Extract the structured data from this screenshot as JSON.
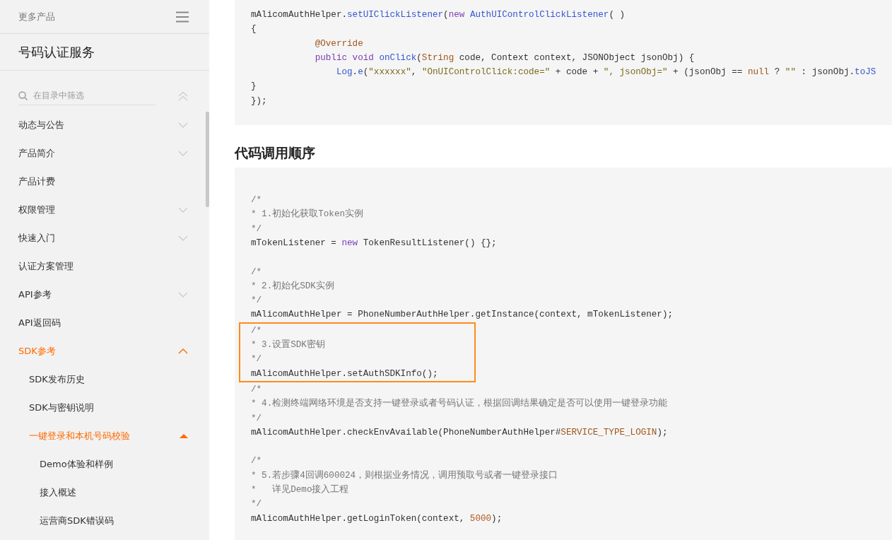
{
  "sidebar": {
    "header": {
      "label": "更多产品"
    },
    "title": "号码认证服务",
    "filter": {
      "placeholder": "在目录中筛选"
    },
    "items": [
      {
        "label": "动态与公告",
        "expandable": true,
        "expanded": false,
        "active": false
      },
      {
        "label": "产品简介",
        "expandable": true,
        "expanded": false,
        "active": false
      },
      {
        "label": "产品计费",
        "expandable": false,
        "active": false
      },
      {
        "label": "权限管理",
        "expandable": true,
        "expanded": false,
        "active": false
      },
      {
        "label": "快速入门",
        "expandable": true,
        "expanded": false,
        "active": false
      },
      {
        "label": "认证方案管理",
        "expandable": false,
        "active": false
      },
      {
        "label": "API参考",
        "expandable": true,
        "expanded": false,
        "active": false
      },
      {
        "label": "API返回码",
        "expandable": false,
        "active": false
      },
      {
        "label": "SDK参考",
        "expandable": true,
        "expanded": true,
        "active": true,
        "children": [
          {
            "label": "SDK发布历史",
            "expandable": false,
            "active": false
          },
          {
            "label": "SDK与密钥说明",
            "expandable": false,
            "active": false
          },
          {
            "label": "一键登录和本机号码校验",
            "expandable": true,
            "expanded": true,
            "active": true,
            "children": [
              {
                "label": "Demo体验和样例",
                "expandable": false,
                "active": false
              },
              {
                "label": "接入概述",
                "expandable": false,
                "active": false
              },
              {
                "label": "运营商SDK错误码",
                "expandable": false,
                "active": false
              }
            ]
          }
        ]
      }
    ]
  },
  "content": {
    "code_blocks": [
      {
        "sections": [
          {
            "highlighted": false,
            "lines": [
              {
                "kind": "code",
                "segments": [
                  {
                    "text": "mAlicomAuthHelper.",
                    "kind": "plain"
                  },
                  {
                    "text": "setUIClickListener",
                    "kind": "func"
                  },
                  {
                    "text": "(",
                    "kind": "plain"
                  },
                  {
                    "text": "new",
                    "kind": "keyword"
                  },
                  {
                    "text": " AuthUIControlClickListener",
                    "kind": "func"
                  },
                  {
                    "text": "( )",
                    "kind": "plain"
                  }
                ]
              },
              {
                "kind": "code",
                "segments": [
                  {
                    "text": "{",
                    "kind": "plain"
                  }
                ]
              },
              {
                "kind": "code",
                "segments": [
                  {
                    "text": "            @Override",
                    "kind": "meta"
                  }
                ]
              },
              {
                "kind": "code",
                "segments": [
                  {
                    "text": "            public void",
                    "kind": "keyword"
                  },
                  {
                    "text": " onClick",
                    "kind": "func"
                  },
                  {
                    "text": "(",
                    "kind": "plain"
                  },
                  {
                    "text": "String",
                    "kind": "type"
                  },
                  {
                    "text": " code, Context context, JSONObject jsonObj) {",
                    "kind": "plain"
                  }
                ]
              },
              {
                "kind": "code",
                "segments": [
                  {
                    "text": "                Log",
                    "kind": "func"
                  },
                  {
                    "text": ".",
                    "kind": "plain"
                  },
                  {
                    "text": "e",
                    "kind": "func"
                  },
                  {
                    "text": "(",
                    "kind": "plain"
                  },
                  {
                    "text": "\"xxxxxx\"",
                    "kind": "string"
                  },
                  {
                    "text": ", ",
                    "kind": "plain"
                  },
                  {
                    "text": "\"OnUIControlClick:code=\"",
                    "kind": "string"
                  },
                  {
                    "text": " + code + ",
                    "kind": "plain"
                  },
                  {
                    "text": "\", jsonObj=\"",
                    "kind": "string"
                  },
                  {
                    "text": " + (jsonObj == ",
                    "kind": "plain"
                  },
                  {
                    "text": "null",
                    "kind": "type"
                  },
                  {
                    "text": " ? ",
                    "kind": "plain"
                  },
                  {
                    "text": "\"\"",
                    "kind": "string"
                  },
                  {
                    "text": " : jsonObj.",
                    "kind": "plain"
                  },
                  {
                    "text": "toJS",
                    "kind": "func"
                  }
                ]
              },
              {
                "kind": "code",
                "segments": [
                  {
                    "text": "}",
                    "kind": "plain"
                  }
                ]
              },
              {
                "kind": "code",
                "segments": [
                  {
                    "text": "});",
                    "kind": "plain"
                  }
                ]
              }
            ]
          }
        ]
      },
      {
        "heading": "代码调用顺序",
        "sections": [
          {
            "highlighted": false,
            "lines": [
              {
                "kind": "code",
                "segments": [
                  {
                    "text": "/*",
                    "kind": "comment"
                  }
                ]
              },
              {
                "kind": "code",
                "segments": [
                  {
                    "text": "* 1.初始化获取Token实例",
                    "kind": "comment"
                  }
                ]
              },
              {
                "kind": "code",
                "segments": [
                  {
                    "text": "*/",
                    "kind": "comment"
                  }
                ]
              },
              {
                "kind": "code",
                "segments": [
                  {
                    "text": "mTokenListener = ",
                    "kind": "plain"
                  },
                  {
                    "text": "new",
                    "kind": "keyword"
                  },
                  {
                    "text": " TokenResultListener() {};",
                    "kind": "plain"
                  }
                ]
              },
              {
                "kind": "blank"
              },
              {
                "kind": "code",
                "segments": [
                  {
                    "text": "/*",
                    "kind": "comment"
                  }
                ]
              },
              {
                "kind": "code",
                "segments": [
                  {
                    "text": "* 2.初始化SDK实例",
                    "kind": "comment"
                  }
                ]
              },
              {
                "kind": "code",
                "segments": [
                  {
                    "text": "*/",
                    "kind": "comment"
                  }
                ]
              },
              {
                "kind": "code",
                "segments": [
                  {
                    "text": "mAlicomAuthHelper = PhoneNumberAuthHelper.getInstance(context, mTokenListener);",
                    "kind": "plain"
                  }
                ]
              }
            ]
          },
          {
            "highlighted": true,
            "lines": [
              {
                "kind": "code",
                "segments": [
                  {
                    "text": "/*",
                    "kind": "comment"
                  }
                ]
              },
              {
                "kind": "code",
                "segments": [
                  {
                    "text": "* 3.设置SDK密钥",
                    "kind": "comment"
                  }
                ]
              },
              {
                "kind": "code",
                "segments": [
                  {
                    "text": "*/",
                    "kind": "comment"
                  }
                ]
              },
              {
                "kind": "code",
                "segments": [
                  {
                    "text": "mAlicomAuthHelper.setAuthSDKInfo();",
                    "kind": "plain"
                  }
                ]
              }
            ]
          },
          {
            "highlighted": false,
            "lines": [
              {
                "kind": "code",
                "segments": [
                  {
                    "text": "/*",
                    "kind": "comment"
                  }
                ]
              },
              {
                "kind": "code",
                "segments": [
                  {
                    "text": "* 4.检测终端网络环境是否支持一键登录或者号码认证，根据回调结果确定是否可以使用一键登录功能",
                    "kind": "comment"
                  }
                ]
              },
              {
                "kind": "code",
                "segments": [
                  {
                    "text": "*/",
                    "kind": "comment"
                  }
                ]
              },
              {
                "kind": "code",
                "segments": [
                  {
                    "text": "mAlicomAuthHelper.checkEnvAvailable(PhoneNumberAuthHelper#",
                    "kind": "plain"
                  },
                  {
                    "text": "SERVICE_TYPE_LOGIN",
                    "kind": "type"
                  },
                  {
                    "text": ");",
                    "kind": "plain"
                  }
                ]
              },
              {
                "kind": "blank"
              },
              {
                "kind": "code",
                "segments": [
                  {
                    "text": "/*",
                    "kind": "comment"
                  }
                ]
              },
              {
                "kind": "code",
                "segments": [
                  {
                    "text": "* 5.若步骤4回调600024，则根据业务情况，调用预取号或者一键登录接口",
                    "kind": "comment"
                  }
                ]
              },
              {
                "kind": "code",
                "segments": [
                  {
                    "text": "*   详见Demo接入工程",
                    "kind": "comment"
                  }
                ]
              },
              {
                "kind": "code",
                "segments": [
                  {
                    "text": "*/",
                    "kind": "comment"
                  }
                ]
              },
              {
                "kind": "code",
                "segments": [
                  {
                    "text": "mAlicomAuthHelper.getLoginToken(context, ",
                    "kind": "plain"
                  },
                  {
                    "text": "5000",
                    "kind": "number"
                  },
                  {
                    "text": ");",
                    "kind": "plain"
                  }
                ]
              }
            ]
          }
        ]
      }
    ]
  }
}
